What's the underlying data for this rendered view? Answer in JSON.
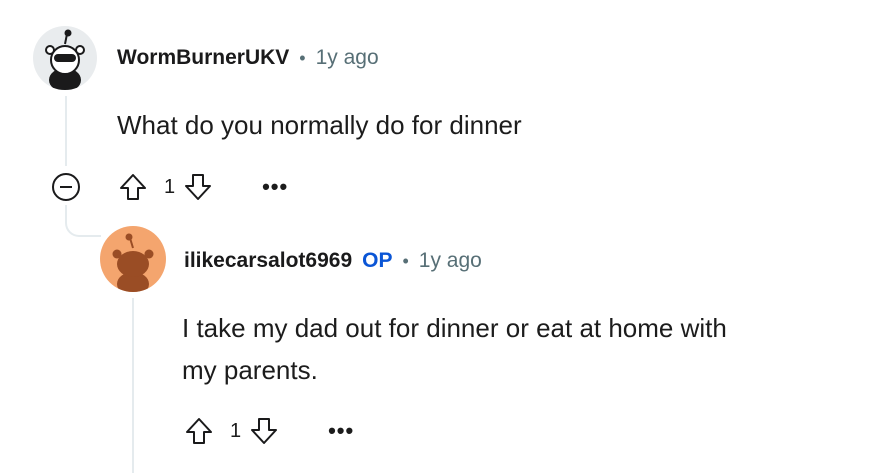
{
  "comments": [
    {
      "username": "WormBurnerUKV",
      "separator": "•",
      "time": "1y ago",
      "body": "What do you normally do for dinner",
      "votes": "1",
      "more": "•••",
      "avatar_color": "#e9ecee",
      "avatar_icon": "snoo-with-sunglasses-icon"
    },
    {
      "username": "ilikecarsalot6969",
      "op_badge": "OP",
      "separator": "•",
      "time": "1y ago",
      "body_line1": "I take my dad out for dinner or eat at home with",
      "body_line2": "my parents.",
      "votes": "1",
      "more": "•••",
      "avatar_color": "#f4a56e",
      "avatar_icon": "snoo-default-icon"
    }
  ],
  "colors": {
    "op": "#0a55d6",
    "meta": "#576f76",
    "thread_line": "#e5ebee"
  }
}
